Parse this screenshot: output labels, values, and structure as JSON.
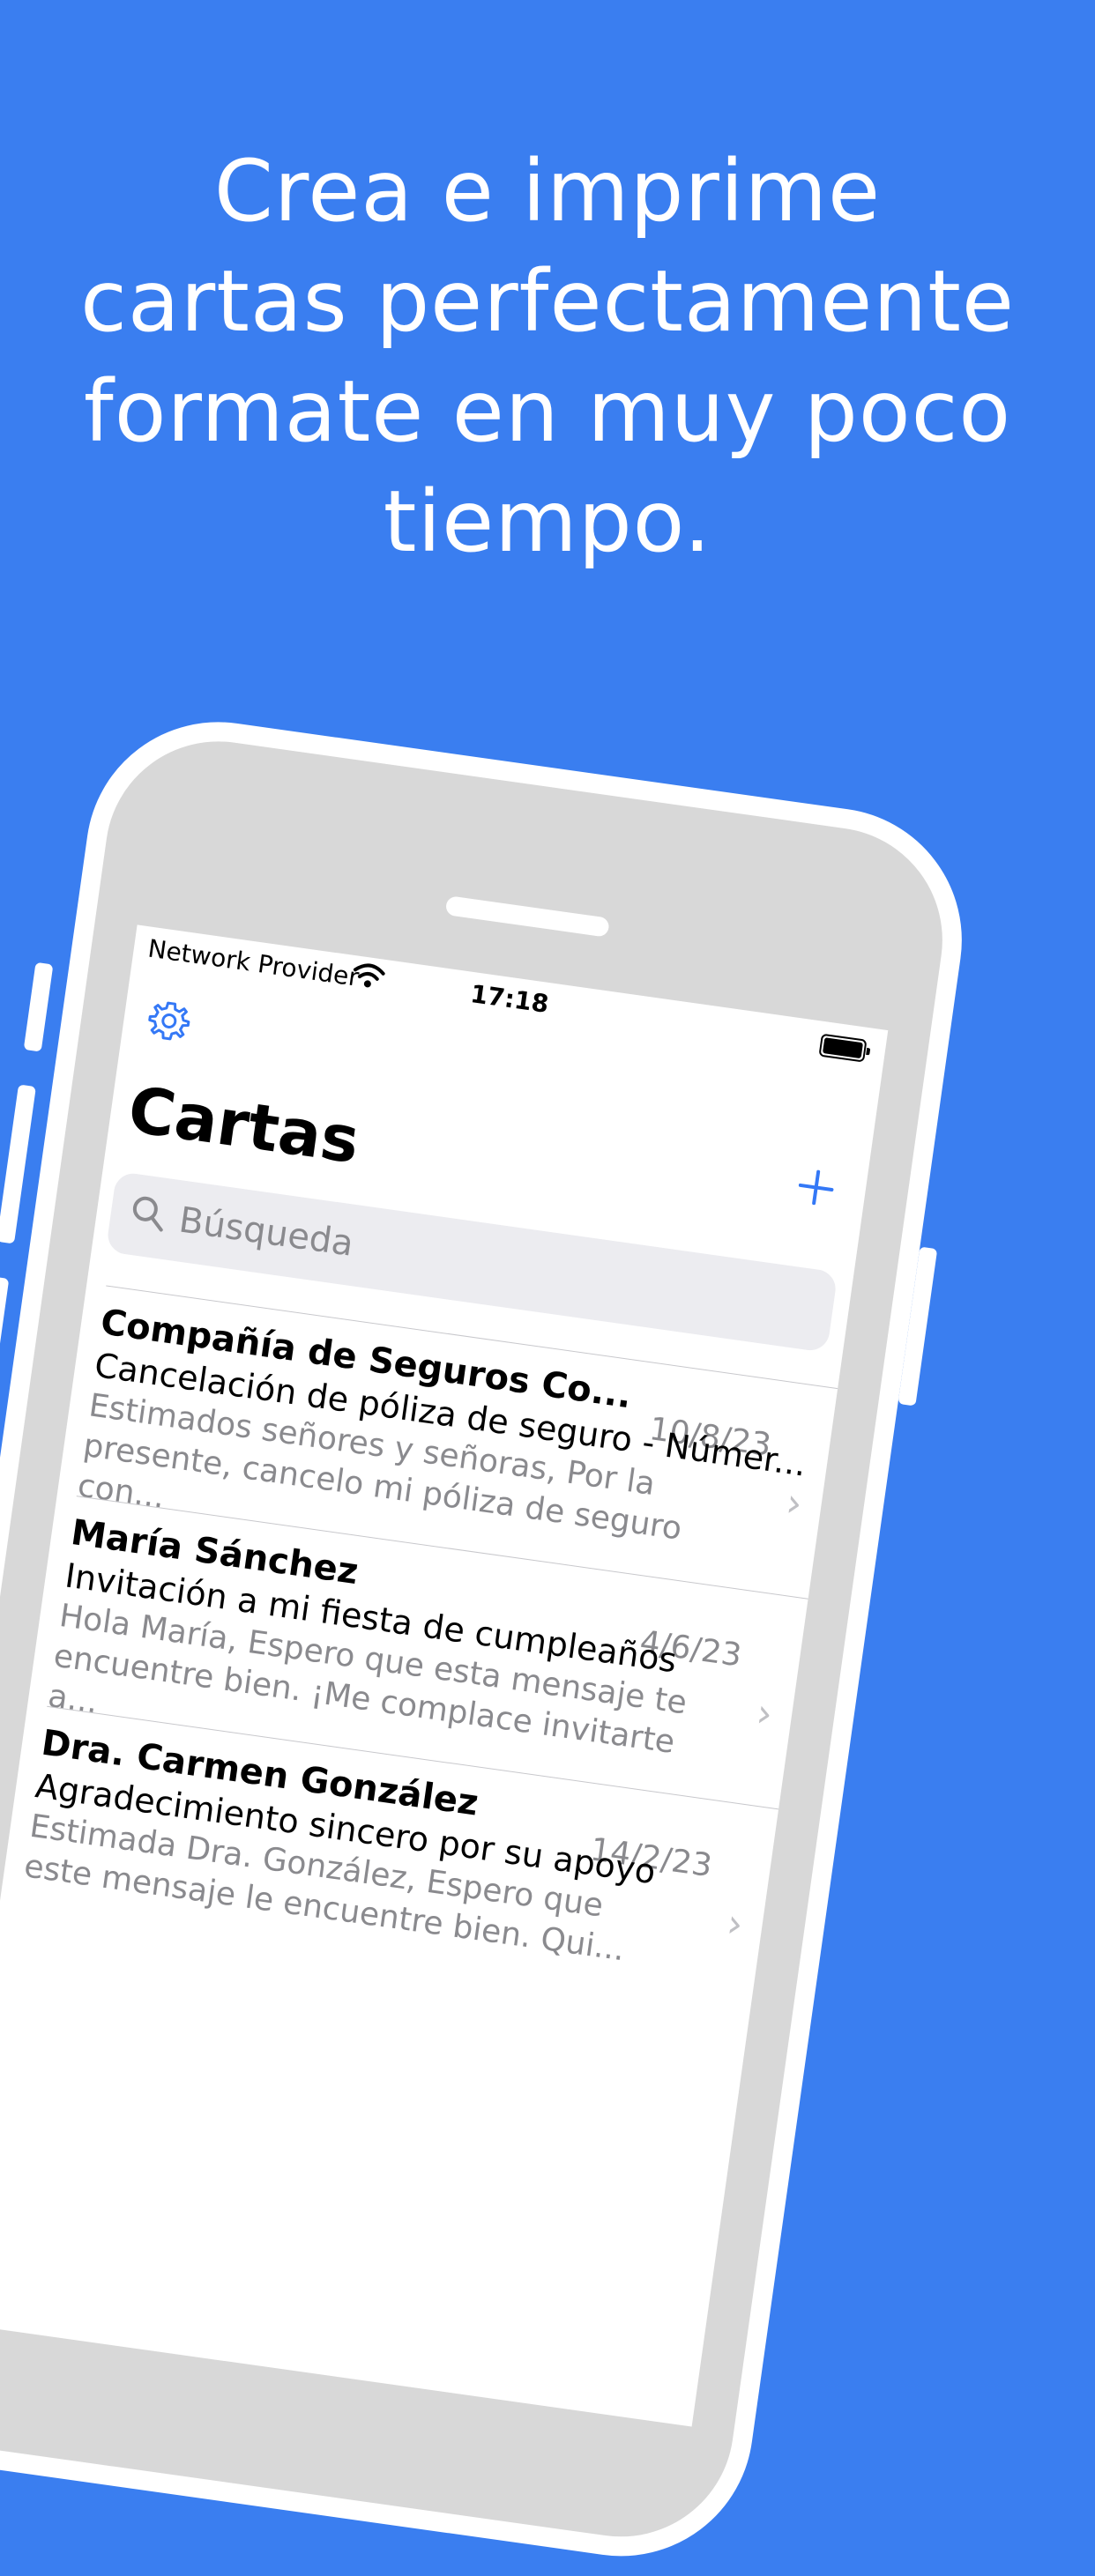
{
  "headline": [
    "Crea e imprime",
    "cartas perfectamente",
    "formate en muy poco",
    "tiempo."
  ],
  "status_bar": {
    "carrier": "Network Provider",
    "time": "17:18"
  },
  "app": {
    "title": "Cartas",
    "search_placeholder": "Búsqueda",
    "settings_icon": "gear-icon",
    "add_icon": "plus-icon",
    "accent_color": "#3478f6"
  },
  "letters": [
    {
      "name": "Compañía de Seguros Co...",
      "date": "10/8/23",
      "subject": "Cancelación de póliza de seguro - Númer...",
      "preview": "Estimados señores y señoras,  Por la presente, cancelo mi póliza de seguro con..."
    },
    {
      "name": "María Sánchez",
      "date": "4/6/23",
      "subject": "Invitación a mi fiesta de cumpleaños",
      "preview": "Hola María,  Espero que esta mensaje te encuentre bien. ¡Me complace invitarte a..."
    },
    {
      "name": "Dra. Carmen González",
      "date": "14/2/23",
      "subject": "Agradecimiento sincero por su apoyo",
      "preview": "Estimada Dra. González,  Espero que este mensaje le encuentre bien. Qui..."
    }
  ],
  "background_color": "#3a7ef0"
}
